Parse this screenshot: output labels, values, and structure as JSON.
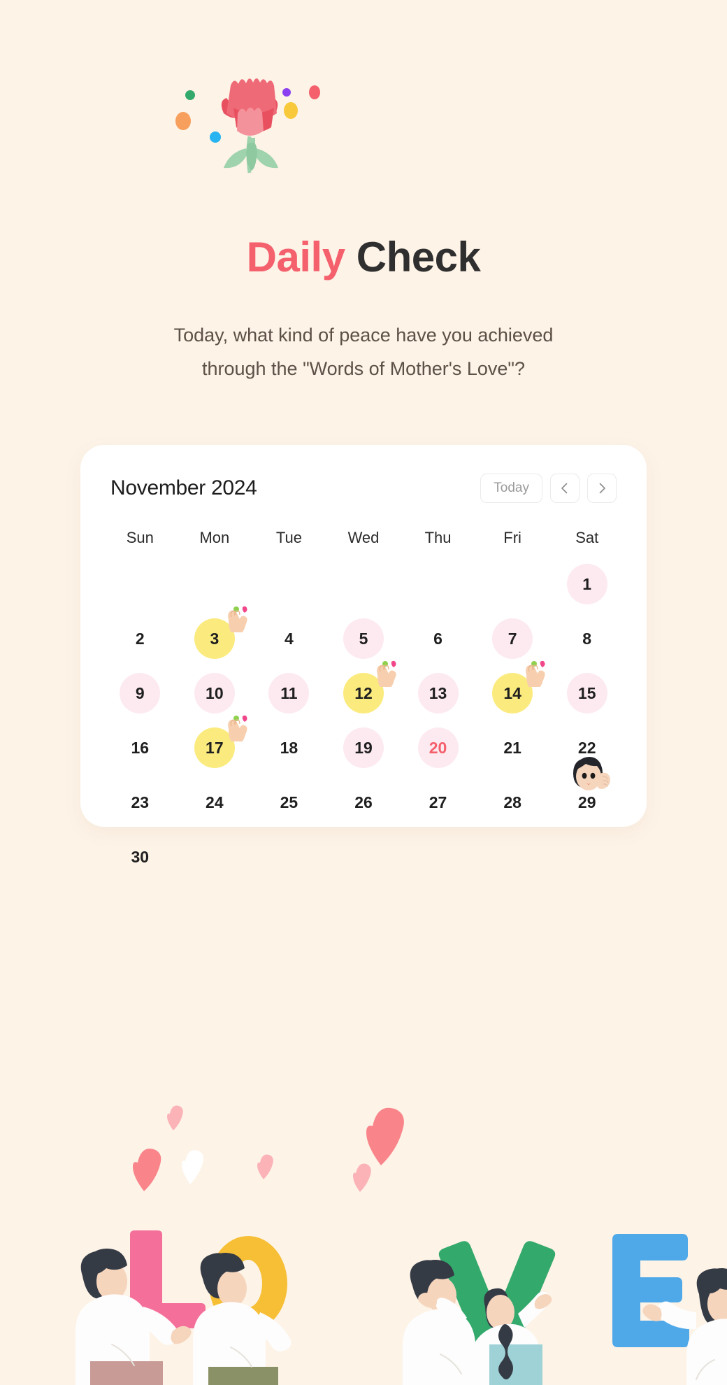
{
  "background_color": "#fdf3e7",
  "header": {
    "art_icon": "carnation-flower-icon",
    "title_accent": "Daily",
    "title_plain": " Check",
    "subtitle_line1": "Today, what kind of peace have you achieved",
    "subtitle_line2": "through the \"Words of Mother's Love\"?",
    "accent_color": "#f4606c",
    "title_color": "#2f2f2f",
    "subtitle_color": "#5d5046"
  },
  "calendar": {
    "month_label": "November 2024",
    "today_button": "Today",
    "prev_button_icon": "chevron-left-icon",
    "next_button_icon": "chevron-right-icon",
    "weekdays": [
      "Sun",
      "Mon",
      "Tue",
      "Wed",
      "Thu",
      "Fri",
      "Sat"
    ],
    "highlight_pink": "#fdeaf0",
    "highlight_yellow": "#fbeb7f",
    "today_text_color": "#f4606c",
    "stamp_icon": "finger-heart-icon",
    "listener_icon": "woman-listening-icon",
    "weeks": [
      [
        {
          "day": "",
          "state": "empty"
        },
        {
          "day": "",
          "state": "empty"
        },
        {
          "day": "",
          "state": "empty"
        },
        {
          "day": "",
          "state": "empty"
        },
        {
          "day": "",
          "state": "empty"
        },
        {
          "day": "",
          "state": "empty"
        },
        {
          "day": "1",
          "state": "pink"
        }
      ],
      [
        {
          "day": "2",
          "state": "plain"
        },
        {
          "day": "3",
          "state": "yellow",
          "stamp": true
        },
        {
          "day": "4",
          "state": "plain"
        },
        {
          "day": "5",
          "state": "pink"
        },
        {
          "day": "6",
          "state": "plain"
        },
        {
          "day": "7",
          "state": "pink"
        },
        {
          "day": "8",
          "state": "plain"
        }
      ],
      [
        {
          "day": "9",
          "state": "pink"
        },
        {
          "day": "10",
          "state": "pink"
        },
        {
          "day": "11",
          "state": "pink"
        },
        {
          "day": "12",
          "state": "yellow",
          "stamp": true
        },
        {
          "day": "13",
          "state": "pink"
        },
        {
          "day": "14",
          "state": "yellow",
          "stamp": true
        },
        {
          "day": "15",
          "state": "pink"
        }
      ],
      [
        {
          "day": "16",
          "state": "plain"
        },
        {
          "day": "17",
          "state": "yellow",
          "stamp": true
        },
        {
          "day": "18",
          "state": "plain"
        },
        {
          "day": "19",
          "state": "pink"
        },
        {
          "day": "20",
          "state": "today"
        },
        {
          "day": "21",
          "state": "plain"
        },
        {
          "day": "22",
          "state": "plain"
        }
      ],
      [
        {
          "day": "23",
          "state": "plain"
        },
        {
          "day": "24",
          "state": "plain"
        },
        {
          "day": "25",
          "state": "plain"
        },
        {
          "day": "26",
          "state": "plain"
        },
        {
          "day": "27",
          "state": "plain"
        },
        {
          "day": "28",
          "state": "plain"
        },
        {
          "day": "29",
          "state": "plain"
        }
      ],
      [
        {
          "day": "30",
          "state": "plain"
        },
        {
          "day": "",
          "state": "empty"
        },
        {
          "day": "",
          "state": "empty"
        },
        {
          "day": "",
          "state": "empty"
        },
        {
          "day": "",
          "state": "empty"
        },
        {
          "day": "",
          "state": "empty"
        },
        {
          "day": "",
          "state": "empty"
        }
      ]
    ]
  },
  "decorations": {
    "hearts_icon": "floating-hearts-icon",
    "love_illustration_icon": "people-holding-love-letters-icon",
    "love_letters": [
      "L",
      "O",
      "V",
      "E"
    ],
    "letter_colors": [
      "#f4709a",
      "#f6bf36",
      "#34a96c",
      "#4fa8e8"
    ],
    "heart_colors": [
      "#f9848a",
      "#fbb3b8",
      "#ffffff"
    ]
  }
}
